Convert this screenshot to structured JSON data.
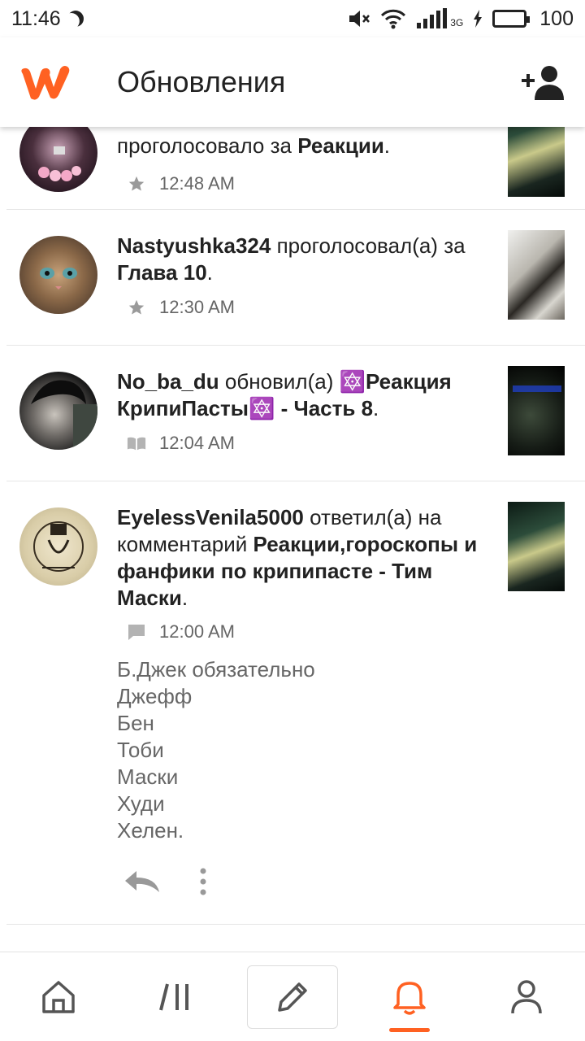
{
  "status_bar": {
    "time": "11:46",
    "network": "3G",
    "battery": "100"
  },
  "app_bar": {
    "title": "Обновления",
    "logo_icon": "wattpad-logo-icon",
    "add_icon": "add-user-icon"
  },
  "feed": [
    {
      "parts": [
        {
          "t": "",
          "b": false
        },
        {
          "t": "проголосовало за ",
          "b": false
        },
        {
          "t": "Реакции",
          "b": true
        },
        {
          "t": ".",
          "b": false
        }
      ],
      "time": "12:48 AM",
      "icon": "star-icon"
    },
    {
      "user": "Nastyushka324",
      "action": " проголосовал(а) за ",
      "target": "Глава 10",
      "end": ".",
      "time": "12:30 AM",
      "icon": "star-icon"
    },
    {
      "user": "No_ba_du",
      "action": " обновил(а) ",
      "target": "🔯Реакция КрипиПасты🔯 - Часть 8",
      "end": ".",
      "time": "12:04 AM",
      "icon": "book-icon"
    },
    {
      "user": "EyelessVenila5000",
      "action": " ответил(а) на комментарий ",
      "target": "Реакции,гороскопы и фанфики по крипипасте - Тим Маски",
      "end": ".",
      "time": "12:00 AM",
      "icon": "comment-icon",
      "comment_lines": [
        "Б.Джек обязательно",
        "Джефф",
        "Бен",
        "Тоби",
        "Маски",
        "Худи",
        "Хелен."
      ]
    }
  ],
  "nav": [
    "home-icon",
    "library-icon",
    "write-icon",
    "notifications-icon",
    "profile-icon"
  ],
  "colors": {
    "accent": "#ff6122",
    "text": "#222222",
    "muted": "#666666"
  }
}
